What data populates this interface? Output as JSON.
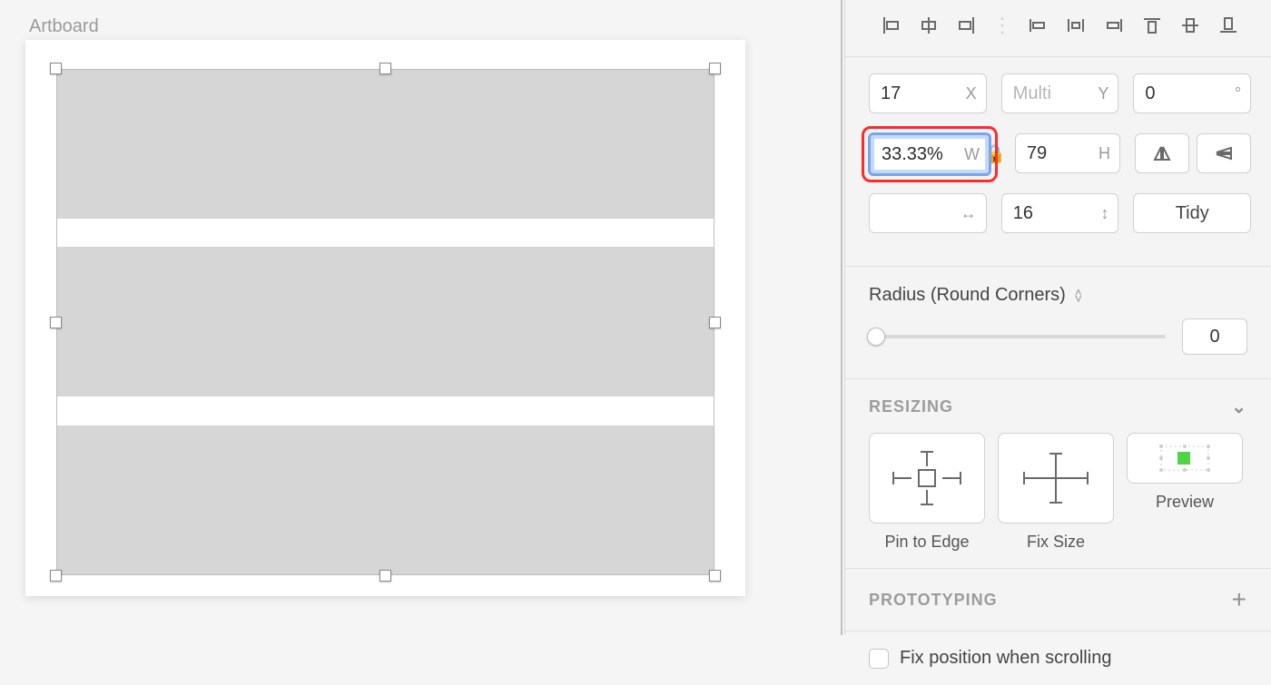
{
  "canvas": {
    "artboard_label": "Artboard"
  },
  "inspector": {
    "position": {
      "x": {
        "value": "17",
        "suffix": "X"
      },
      "y": {
        "placeholder": "Multi",
        "suffix": "Y"
      },
      "rot": {
        "value": "0",
        "suffix": "°"
      },
      "w": {
        "value": "33.33%",
        "suffix": "W"
      },
      "h": {
        "value": "79",
        "suffix": "H"
      },
      "spacing_h": {
        "value": "",
        "suffix": "↔"
      },
      "spacing_v": {
        "value": "16"
      },
      "tidy_label": "Tidy"
    },
    "radius": {
      "label": "Radius (Round Corners)",
      "value": "0"
    },
    "resizing": {
      "header": "RESIZING",
      "pin_label": "Pin to Edge",
      "fix_label": "Fix Size",
      "preview_label": "Preview"
    },
    "prototyping": {
      "header": "PROTOTYPING"
    },
    "fix_position_label": "Fix position when scrolling"
  }
}
